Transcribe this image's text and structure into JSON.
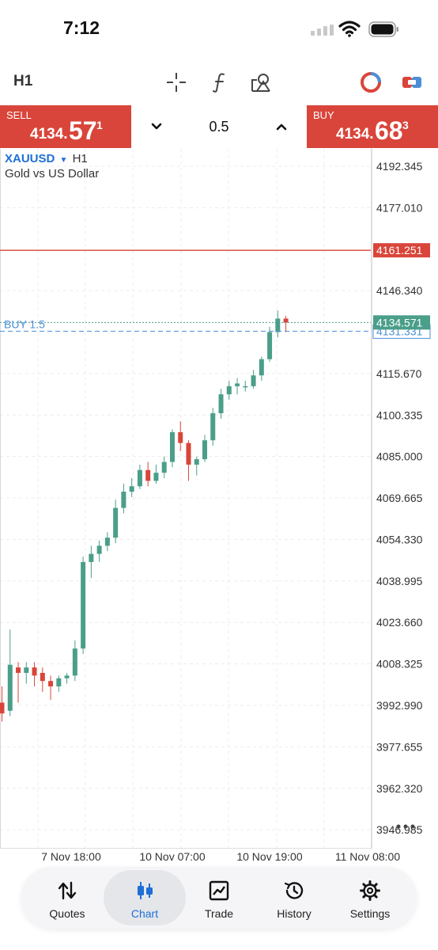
{
  "status": {
    "time": "7:12"
  },
  "toolbar": {
    "timeframe": "H1",
    "icons": [
      "crosshair-icon",
      "indicator-icon",
      "objects-icon",
      "color-scheme-icon",
      "one-click-trading-icon"
    ]
  },
  "trade": {
    "sell_label": "SELL",
    "sell_price_main": "4134.",
    "sell_price_big": "57",
    "sell_price_sup": "1",
    "buy_label": "BUY",
    "buy_price_main": "4134.",
    "buy_price_big": "68",
    "buy_price_sup": "3",
    "volume": "0.5",
    "accent_color": "#d9453a"
  },
  "chart": {
    "symbol": "XAUUSD",
    "timeframe": "H1",
    "description": "Gold vs US Dollar",
    "position_label": "BUY 1.5"
  },
  "chart_data": {
    "type": "candlestick",
    "price_axis_ticks": [
      "4192.345",
      "4177.010",
      "4146.340",
      "4115.670",
      "4100.335",
      "4085.000",
      "4069.665",
      "4054.330",
      "4038.995",
      "4023.660",
      "4008.325",
      "3992.990",
      "3977.655",
      "3962.320",
      "3946.985"
    ],
    "time_axis_ticks": [
      "7 Nov 18:00",
      "10 Nov 07:00",
      "10 Nov 19:00",
      "11 Nov 08:00"
    ],
    "ylim": [
      3940,
      4198
    ],
    "price_lines": [
      {
        "label": "4161.251",
        "value": 4161.251,
        "kind": "alert",
        "color": "#d9453a"
      },
      {
        "label": "4134.571",
        "value": 4134.571,
        "kind": "bid",
        "color": "#4a9e8a"
      },
      {
        "label": "4131.331",
        "value": 4131.331,
        "kind": "position",
        "color": "#4a8fd6"
      }
    ],
    "up_color": "#4a9e8a",
    "down_color": "#d9453a",
    "candles": [
      {
        "o": 3994,
        "h": 4000,
        "l": 3987,
        "c": 3990
      },
      {
        "o": 3991,
        "h": 4021,
        "l": 3989,
        "c": 4008
      },
      {
        "o": 4007,
        "h": 4009,
        "l": 3994,
        "c": 4005
      },
      {
        "o": 4005,
        "h": 4009,
        "l": 4001,
        "c": 4007
      },
      {
        "o": 4007,
        "h": 4009,
        "l": 4000,
        "c": 4004
      },
      {
        "o": 4005,
        "h": 4007,
        "l": 3998,
        "c": 4002
      },
      {
        "o": 4002,
        "h": 4004,
        "l": 3995,
        "c": 4000
      },
      {
        "o": 4000,
        "h": 4004,
        "l": 3998,
        "c": 4003
      },
      {
        "o": 4003,
        "h": 4005,
        "l": 4001,
        "c": 4004
      },
      {
        "o": 4004,
        "h": 4017,
        "l": 4002,
        "c": 4014
      },
      {
        "o": 4014,
        "h": 4048,
        "l": 4012,
        "c": 4046
      },
      {
        "o": 4046,
        "h": 4052,
        "l": 4040,
        "c": 4049
      },
      {
        "o": 4049,
        "h": 4054,
        "l": 4046,
        "c": 4052
      },
      {
        "o": 4052,
        "h": 4057,
        "l": 4050,
        "c": 4055
      },
      {
        "o": 4055,
        "h": 4069,
        "l": 4053,
        "c": 4066
      },
      {
        "o": 4066,
        "h": 4075,
        "l": 4064,
        "c": 4072
      },
      {
        "o": 4072,
        "h": 4077,
        "l": 4070,
        "c": 4074
      },
      {
        "o": 4074,
        "h": 4082,
        "l": 4073,
        "c": 4080
      },
      {
        "o": 4080,
        "h": 4083,
        "l": 4074,
        "c": 4076
      },
      {
        "o": 4076,
        "h": 4082,
        "l": 4075,
        "c": 4079
      },
      {
        "o": 4079,
        "h": 4085,
        "l": 4077,
        "c": 4083
      },
      {
        "o": 4083,
        "h": 4095,
        "l": 4081,
        "c": 4094
      },
      {
        "o": 4094,
        "h": 4098,
        "l": 4087,
        "c": 4090
      },
      {
        "o": 4090,
        "h": 4091,
        "l": 4076,
        "c": 4082
      },
      {
        "o": 4082,
        "h": 4085,
        "l": 4078,
        "c": 4084
      },
      {
        "o": 4084,
        "h": 4093,
        "l": 4083,
        "c": 4091
      },
      {
        "o": 4091,
        "h": 4103,
        "l": 4089,
        "c": 4101
      },
      {
        "o": 4101,
        "h": 4110,
        "l": 4099,
        "c": 4108
      },
      {
        "o": 4108,
        "h": 4113,
        "l": 4106,
        "c": 4111
      },
      {
        "o": 4111,
        "h": 4114,
        "l": 4108,
        "c": 4112
      },
      {
        "o": 4111,
        "h": 4113,
        "l": 4109,
        "c": 4111
      },
      {
        "o": 4111,
        "h": 4117,
        "l": 4110,
        "c": 4115
      },
      {
        "o": 4115,
        "h": 4122,
        "l": 4113,
        "c": 4121
      },
      {
        "o": 4121,
        "h": 4133,
        "l": 4120,
        "c": 4131
      },
      {
        "o": 4131,
        "h": 4139,
        "l": 4129,
        "c": 4136
      },
      {
        "o": 4136,
        "h": 4137,
        "l": 4131,
        "c": 4134.5
      }
    ]
  },
  "nav": {
    "items": [
      {
        "label": "Quotes",
        "icon": "quotes-arrows-icon"
      },
      {
        "label": "Chart",
        "icon": "candlestick-icon"
      },
      {
        "label": "Trade",
        "icon": "trade-chart-icon"
      },
      {
        "label": "History",
        "icon": "history-clock-icon"
      },
      {
        "label": "Settings",
        "icon": "gear-icon"
      }
    ],
    "active": "Chart",
    "active_color": "#1f6fd6"
  }
}
